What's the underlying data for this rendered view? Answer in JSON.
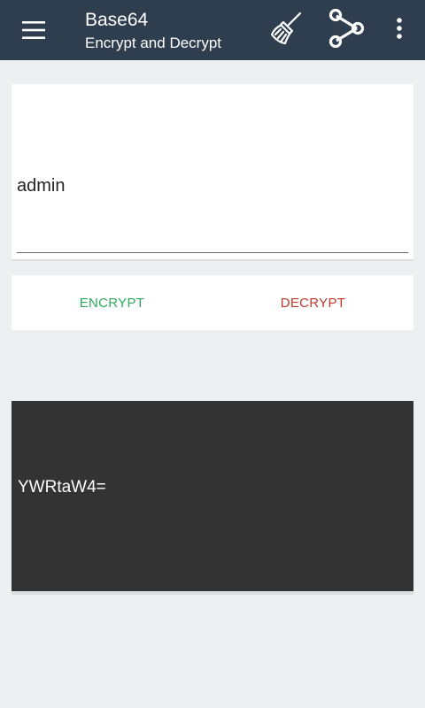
{
  "app_bar": {
    "title": "Base64",
    "subtitle": "Encrypt and Decrypt",
    "icons": {
      "menu": "hamburger-menu-icon",
      "clear": "broom-icon",
      "share": "share-icon",
      "overflow": "more-vert-icon"
    }
  },
  "input": {
    "value": "admin"
  },
  "actions": {
    "encrypt_label": "ENCRYPT",
    "decrypt_label": "DECRYPT"
  },
  "output": {
    "value": "YWRtaW4="
  },
  "colors": {
    "app_bar": "#2f3e4e",
    "background": "#eeeff1",
    "encrypt": "#2eaa5c",
    "decrypt": "#c0392b",
    "output_bg": "#333333"
  }
}
